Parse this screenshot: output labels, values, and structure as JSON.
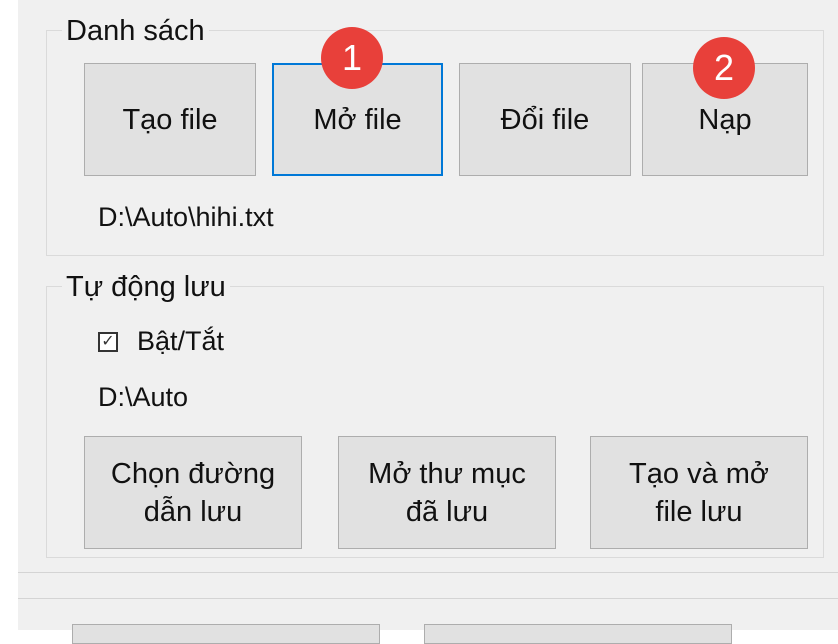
{
  "danh_sach": {
    "title": "Danh sách",
    "buttons": {
      "tao_file": "Tạo file",
      "mo_file": "Mở file",
      "doi_file": "Đổi file",
      "nap": "Nạp"
    },
    "path": "D:\\Auto\\hihi.txt"
  },
  "tu_dong_luu": {
    "title": "Tự động lưu",
    "checkbox_label": "Bật/Tắt",
    "checked": true,
    "check_mark": "✓",
    "path": "D:\\Auto",
    "buttons": {
      "chon_duong_dan": "Chọn đường\ndẫn lưu",
      "mo_thu_muc": "Mở thư mục\nđã lưu",
      "tao_va_mo": "Tạo và mở\nfile lưu"
    }
  },
  "badges": [
    "1",
    "2"
  ],
  "colors": {
    "badge": "#e8403a",
    "focus_border": "#0078d7",
    "button_bg": "#e1e1e1"
  }
}
